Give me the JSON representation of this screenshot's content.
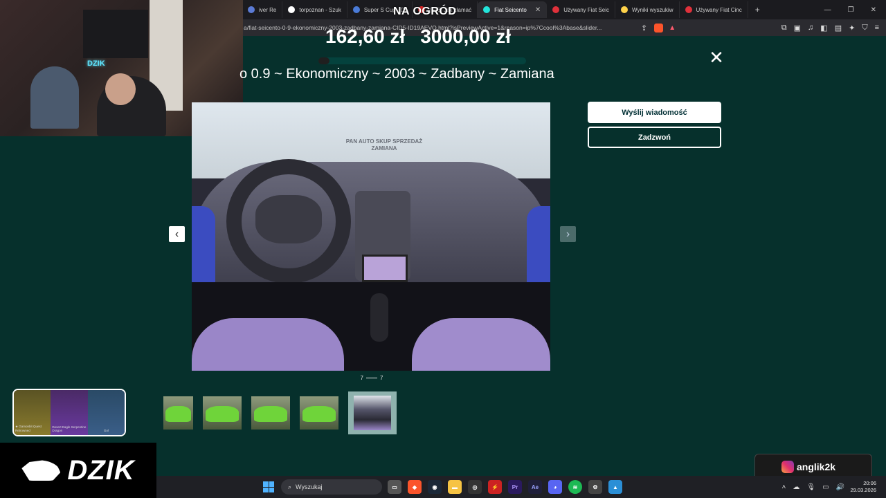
{
  "browser": {
    "tabs": [
      {
        "label": "iver Re",
        "color": "#5b7bd5"
      },
      {
        "label": "torpoznan - Szuk",
        "color": "#ffffff"
      },
      {
        "label": "Super S Cup - Dr",
        "color": "#4a7bd8"
      },
      {
        "label": "(546) Jak złamać",
        "color": "#ff2b2b"
      },
      {
        "label": "Fiat Seicento",
        "color": "#23e5db",
        "active": true
      },
      {
        "label": "Używany Fiat Seic",
        "color": "#e0313b"
      },
      {
        "label": "Wyniki wyszukiw",
        "color": "#ffd24a"
      },
      {
        "label": "Używany Fiat Cinc",
        "color": "#e0313b"
      }
    ],
    "tab_close": "✕",
    "new_tab": "+",
    "url": "a/fiat-seicento-0-9-ekonomiczny-2003-zadbany-zamiana-CID5-ID19AEVO.html?isPreviewActive=1&reason=ip%7Ccool%3Abase&slider..."
  },
  "stream": {
    "title": "NA OGRÓD",
    "price_current": "162,60 zł",
    "price_goal": "3000,00 zł",
    "progress_fraction": 0.054,
    "webcam_sign": "DZIK",
    "logo_text": "DZIK",
    "instagram_handle": "anglik2k",
    "case_cards": [
      "★ Gamonbit Quest Retrowned",
      "Desert Eagle Serpentine Dragon",
      "Gol"
    ]
  },
  "listing": {
    "title": "o 0.9 ~ Ekonomiczny ~ 2003 ~ Zadbany ~ Zamiana",
    "photo_watermark": "PAN AUTO SKUP SPRZEDAŻ ZAMIANA",
    "counter_current": "7",
    "counter_total": "7",
    "send_message_label": "Wyślij wiadomość",
    "call_label": "Zadzwoń",
    "thumbnails": 5
  },
  "taskbar": {
    "search_placeholder": "Wyszukaj",
    "time": "20:06",
    "date": "29.03.2026"
  }
}
